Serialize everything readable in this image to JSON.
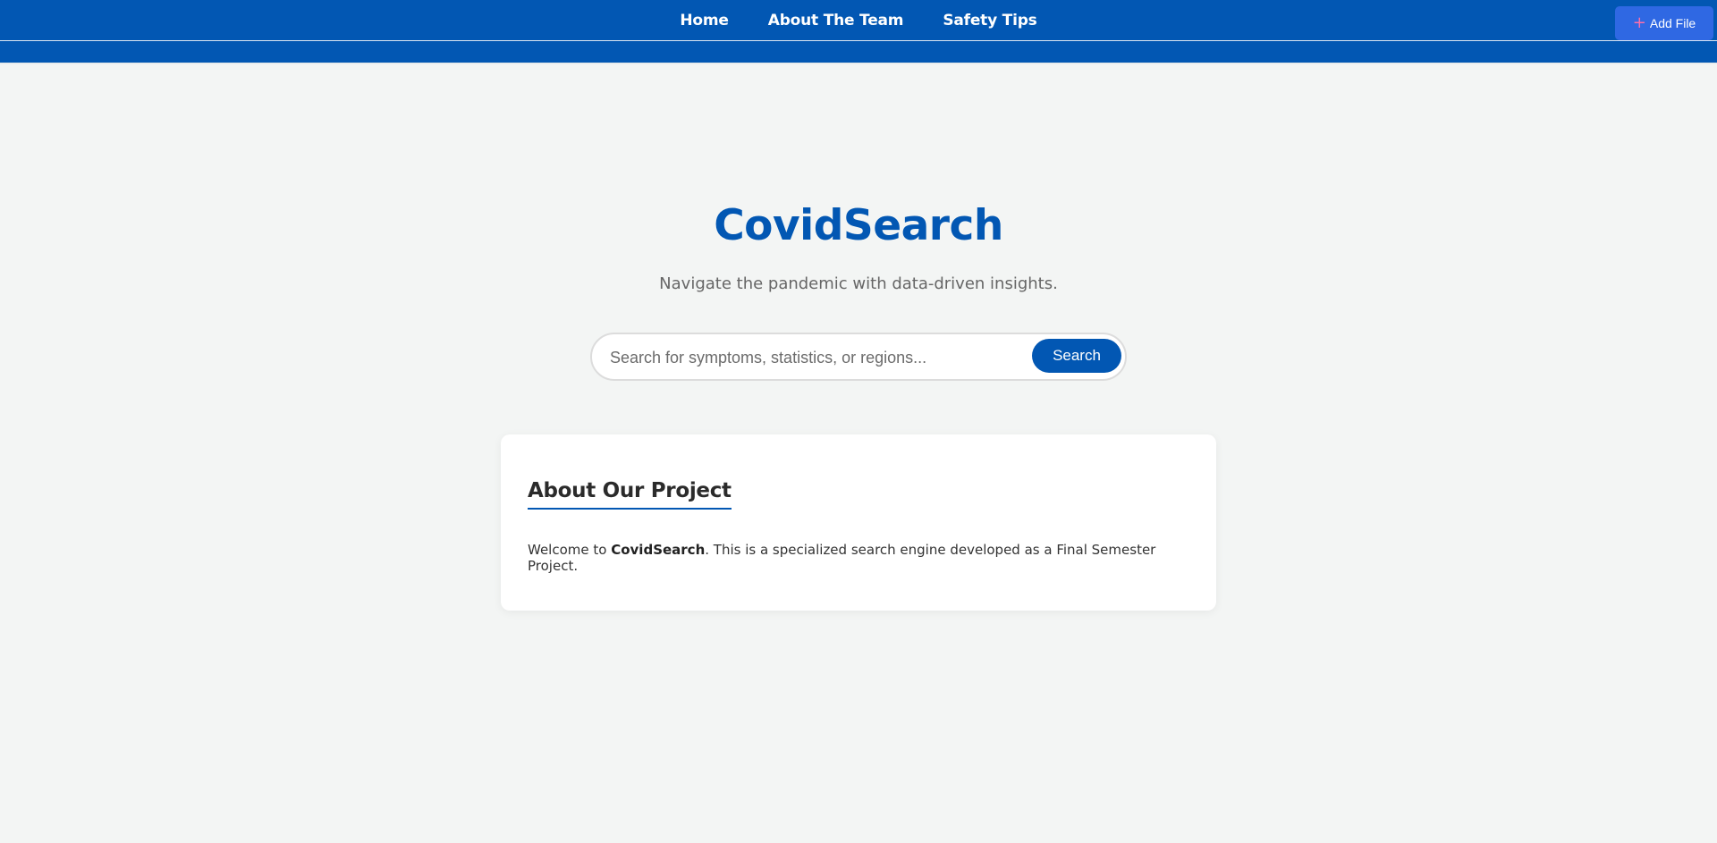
{
  "nav": {
    "items": [
      "Home",
      "About The Team",
      "Safety Tips"
    ]
  },
  "toolbar": {
    "add_file_label": "Add File",
    "add_file_icon": "plus-icon"
  },
  "hero": {
    "title": "CovidSearch",
    "subtitle": "Navigate the pandemic with data-driven insights."
  },
  "search": {
    "placeholder": "Search for symptoms, statistics, or regions...",
    "value": "",
    "button_label": "Search"
  },
  "about": {
    "heading": "About Our Project",
    "text_before": "Welcome to ",
    "text_bold": "CovidSearch",
    "text_after": ". This is a specialized search engine developed as a Final Semester Project."
  },
  "colors": {
    "brand": "#0257b3",
    "add_file_bg": "#2f68e3",
    "page_bg": "#f3f5f4"
  }
}
